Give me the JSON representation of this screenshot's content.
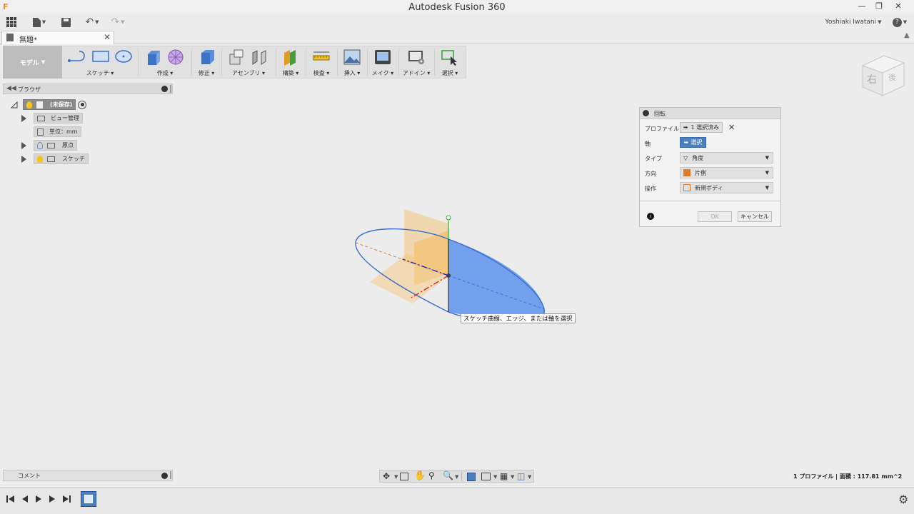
{
  "app": {
    "title": "Autodesk Fusion 360",
    "user": "Yoshiaki Iwatani",
    "help": "?"
  },
  "document_tab": {
    "label": "無題*"
  },
  "toolbar": {
    "workspace": "モデル",
    "groups": [
      {
        "label": "スケッチ"
      },
      {
        "label": "作成"
      },
      {
        "label": "修正"
      },
      {
        "label": "アセンブリ"
      },
      {
        "label": "構築"
      },
      {
        "label": "検査"
      },
      {
        "label": "挿入"
      },
      {
        "label": "メイク"
      },
      {
        "label": "アドイン"
      },
      {
        "label": "選択"
      }
    ]
  },
  "browser": {
    "title": "ブラウザ",
    "root": "(未保存)",
    "items": [
      {
        "label": "ビュー管理"
      },
      {
        "label": "単位：mm"
      },
      {
        "label": "原点"
      },
      {
        "label": "スケッチ"
      }
    ]
  },
  "viewcube": {
    "face": "右",
    "face2": "後"
  },
  "dialog": {
    "title": "回転",
    "profile_label": "プロファイル",
    "profile_value": "1 選択済み",
    "axis_label": "軸",
    "axis_value": "選択",
    "type_label": "タイプ",
    "type_value": "角度",
    "direction_label": "方向",
    "direction_value": "片側",
    "operation_label": "操作",
    "operation_value": "新規ボディ",
    "ok": "OK",
    "cancel": "キャンセル"
  },
  "tooltip": "スケッチ曲線、エッジ、または軸を選択",
  "comment": {
    "label": "コメント"
  },
  "status": "1 プロファイル | 面積 : 117.81 mm^2",
  "colors": {
    "accent": "#4a7fc1",
    "profile_fill": "#6d9cec",
    "origin_plane": "#f5c77e",
    "axis_x": "#d22",
    "axis_y": "#2b2",
    "axis_z": "#22c"
  }
}
